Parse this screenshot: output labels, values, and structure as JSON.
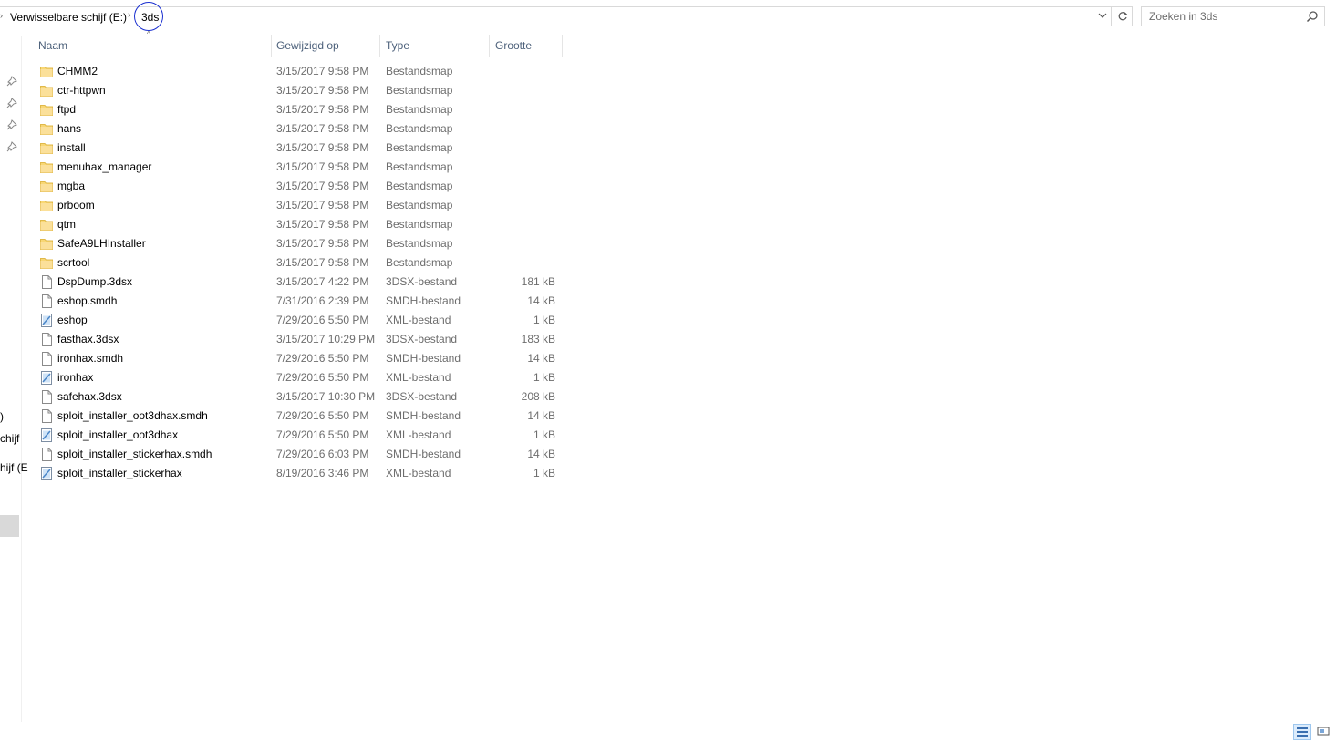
{
  "addressbar": {
    "drive_label": "Verwisselbare schijf (E:)",
    "separator": "›",
    "current_folder": "3ds"
  },
  "search": {
    "placeholder": "Zoeken in 3ds"
  },
  "navpane": {
    "fragments": [
      ")",
      "chijf",
      "hijf (E"
    ]
  },
  "columns": {
    "name": "Naam",
    "modified": "Gewijzigd op",
    "type": "Type",
    "size": "Grootte"
  },
  "files": [
    {
      "name": "CHMM2",
      "modified": "3/15/2017 9:58 PM",
      "type": "Bestandsmap",
      "size": "",
      "icon": "folder"
    },
    {
      "name": "ctr-httpwn",
      "modified": "3/15/2017 9:58 PM",
      "type": "Bestandsmap",
      "size": "",
      "icon": "folder"
    },
    {
      "name": "ftpd",
      "modified": "3/15/2017 9:58 PM",
      "type": "Bestandsmap",
      "size": "",
      "icon": "folder"
    },
    {
      "name": "hans",
      "modified": "3/15/2017 9:58 PM",
      "type": "Bestandsmap",
      "size": "",
      "icon": "folder"
    },
    {
      "name": "install",
      "modified": "3/15/2017 9:58 PM",
      "type": "Bestandsmap",
      "size": "",
      "icon": "folder"
    },
    {
      "name": "menuhax_manager",
      "modified": "3/15/2017 9:58 PM",
      "type": "Bestandsmap",
      "size": "",
      "icon": "folder"
    },
    {
      "name": "mgba",
      "modified": "3/15/2017 9:58 PM",
      "type": "Bestandsmap",
      "size": "",
      "icon": "folder"
    },
    {
      "name": "prboom",
      "modified": "3/15/2017 9:58 PM",
      "type": "Bestandsmap",
      "size": "",
      "icon": "folder"
    },
    {
      "name": "qtm",
      "modified": "3/15/2017 9:58 PM",
      "type": "Bestandsmap",
      "size": "",
      "icon": "folder"
    },
    {
      "name": "SafeA9LHInstaller",
      "modified": "3/15/2017 9:58 PM",
      "type": "Bestandsmap",
      "size": "",
      "icon": "folder"
    },
    {
      "name": "scrtool",
      "modified": "3/15/2017 9:58 PM",
      "type": "Bestandsmap",
      "size": "",
      "icon": "folder"
    },
    {
      "name": "DspDump.3dsx",
      "modified": "3/15/2017 4:22 PM",
      "type": "3DSX-bestand",
      "size": "181 kB",
      "icon": "file"
    },
    {
      "name": "eshop.smdh",
      "modified": "7/31/2016 2:39 PM",
      "type": "SMDH-bestand",
      "size": "14 kB",
      "icon": "file"
    },
    {
      "name": "eshop",
      "modified": "7/29/2016 5:50 PM",
      "type": "XML-bestand",
      "size": "1 kB",
      "icon": "xml"
    },
    {
      "name": "fasthax.3dsx",
      "modified": "3/15/2017 10:29 PM",
      "type": "3DSX-bestand",
      "size": "183 kB",
      "icon": "file"
    },
    {
      "name": "ironhax.smdh",
      "modified": "7/29/2016 5:50 PM",
      "type": "SMDH-bestand",
      "size": "14 kB",
      "icon": "file"
    },
    {
      "name": "ironhax",
      "modified": "7/29/2016 5:50 PM",
      "type": "XML-bestand",
      "size": "1 kB",
      "icon": "xml"
    },
    {
      "name": "safehax.3dsx",
      "modified": "3/15/2017 10:30 PM",
      "type": "3DSX-bestand",
      "size": "208 kB",
      "icon": "file"
    },
    {
      "name": "sploit_installer_oot3dhax.smdh",
      "modified": "7/29/2016 5:50 PM",
      "type": "SMDH-bestand",
      "size": "14 kB",
      "icon": "file"
    },
    {
      "name": "sploit_installer_oot3dhax",
      "modified": "7/29/2016 5:50 PM",
      "type": "XML-bestand",
      "size": "1 kB",
      "icon": "xml"
    },
    {
      "name": "sploit_installer_stickerhax.smdh",
      "modified": "7/29/2016 6:03 PM",
      "type": "SMDH-bestand",
      "size": "14 kB",
      "icon": "file"
    },
    {
      "name": "sploit_installer_stickerhax",
      "modified": "8/19/2016 3:46 PM",
      "type": "XML-bestand",
      "size": "1 kB",
      "icon": "xml"
    }
  ],
  "colors": {
    "folder": "#f8d775",
    "header_text": "#4c607a",
    "annotation": "#1a2fd0"
  }
}
